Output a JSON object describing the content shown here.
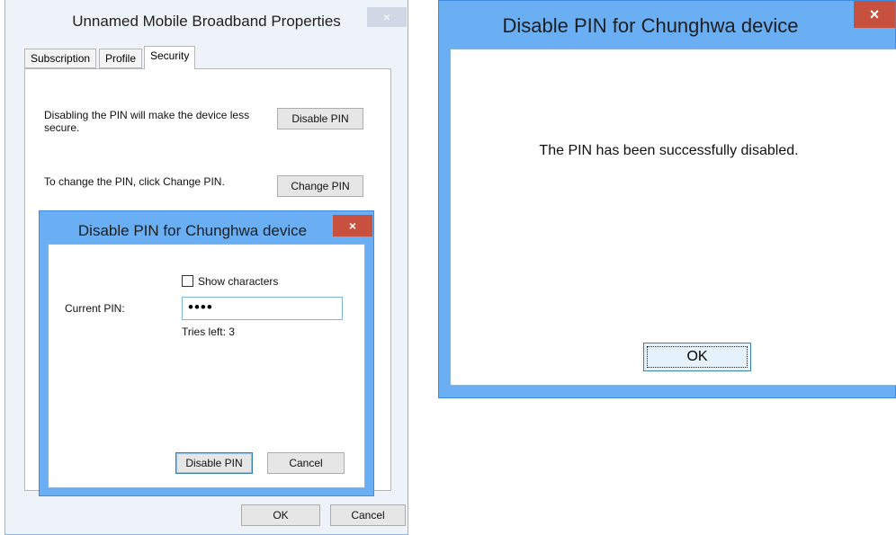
{
  "properties_window": {
    "title": "Unnamed Mobile Broadband Properties",
    "close_glyph": "×",
    "tabs": [
      "Subscription",
      "Profile",
      "Security"
    ],
    "active_tab": "Security",
    "disable_text": "Disabling the PIN will make the device less secure.",
    "disable_button": "Disable PIN",
    "change_text": "To change the PIN, click Change PIN.",
    "change_button": "Change PIN",
    "ok_button": "OK",
    "cancel_button": "Cancel"
  },
  "pin_dialog": {
    "title": "Disable PIN for Chunghwa device",
    "close_glyph": "×",
    "show_characters_label": "Show characters",
    "show_characters_checked": false,
    "current_pin_label": "Current PIN:",
    "pin_value": "••••",
    "tries_left": "Tries left: 3",
    "disable_button": "Disable PIN",
    "cancel_button": "Cancel"
  },
  "result_dialog": {
    "title": "Disable PIN for Chunghwa device",
    "close_glyph": "×",
    "message": "The PIN has been successfully disabled.",
    "ok_button": "OK"
  },
  "colors": {
    "titlebar_blue": "#6aaff3",
    "close_red": "#c7503f",
    "inactive_frame": "#eef3fa"
  },
  "icons": [
    "close-icon"
  ]
}
